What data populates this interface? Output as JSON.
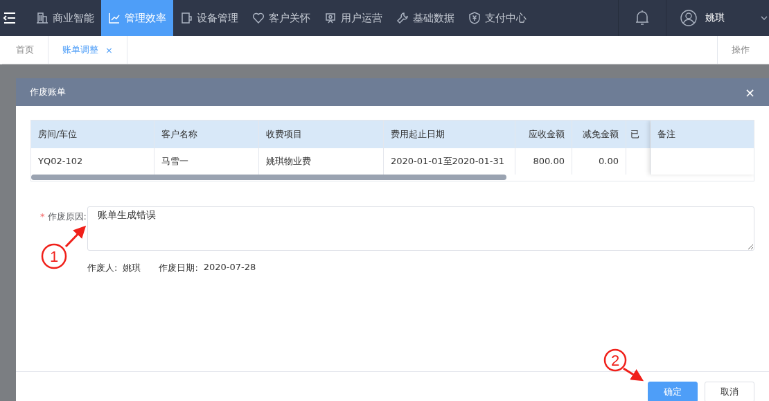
{
  "nav": {
    "items": [
      {
        "label": "商业智能",
        "selected": false
      },
      {
        "label": "管理效率",
        "selected": true
      },
      {
        "label": "设备管理",
        "selected": false
      },
      {
        "label": "客户关怀",
        "selected": false
      },
      {
        "label": "用户运营",
        "selected": false
      },
      {
        "label": "基础数据",
        "selected": false
      },
      {
        "label": "支付中心",
        "selected": false
      }
    ],
    "user": "姚琪"
  },
  "tabs": {
    "items": [
      {
        "label": "首页",
        "selected": false
      },
      {
        "label": "账单调整",
        "selected": true,
        "close": "×"
      }
    ],
    "actions": "操作"
  },
  "dialog": {
    "title": "作废账单",
    "close_symbol": "×",
    "table": {
      "columns": [
        "房间/车位",
        "客户名称",
        "收费项目",
        "费用起止日期",
        "应收金额",
        "减免金额",
        "已"
      ],
      "rows": [
        [
          "YQ02-102",
          "马雪一",
          "姚琪物业费",
          "2020-01-01至2020-01-31",
          "800.00",
          "0.00",
          ""
        ]
      ],
      "fixed_column": "备注"
    },
    "reason": {
      "required_mark": "*",
      "label": "作废原因:",
      "value": "账单生成错误"
    },
    "meta": [
      {
        "label": "作废人:",
        "value": "姚琪"
      },
      {
        "label": "作废日期:",
        "value": "2020-07-28"
      }
    ],
    "buttons": [
      {
        "label": "确定",
        "kind": "primary"
      },
      {
        "label": "取消",
        "kind": "default"
      }
    ]
  },
  "annotations": [
    {
      "label": "1"
    },
    {
      "label": "2"
    }
  ]
}
